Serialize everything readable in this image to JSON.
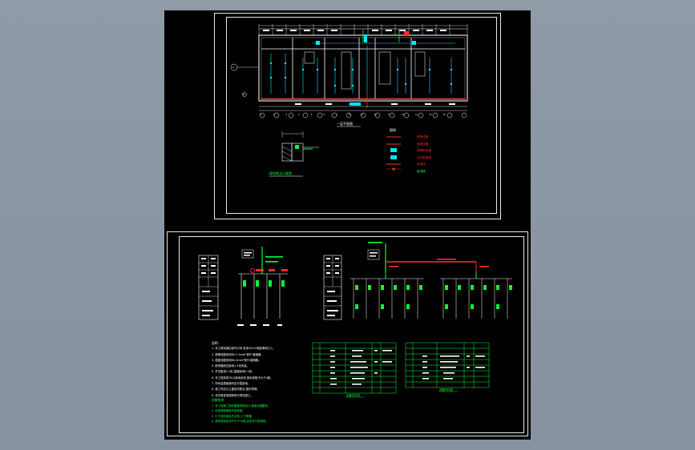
{
  "sheet1": {
    "grid_numbers": [
      "1",
      "2",
      "3",
      "4",
      "5",
      "6",
      "7",
      "8",
      "9",
      "10",
      "11",
      "12",
      "13",
      "14",
      "15",
      "16"
    ],
    "side_labels": [
      "A",
      "B"
    ],
    "plan_caption": "一层平面图",
    "detail_caption": "接地做法示意图",
    "legend_title": "图例",
    "legend_items": [
      "照明线路",
      "插座线路",
      "照明配电箱",
      "动力配电箱",
      "接地线",
      "接地极"
    ]
  },
  "sheet2": {
    "notes_title": "说明:",
    "notes": [
      "1. 本工程电源由室外引来,采用YJV22电缆埋地引入。",
      "2. 照明线路采用BV-2.5mm²穿PC管暗敷。",
      "3. 插座线路采用BV-4mm²穿PC管暗敷。",
      "4. 配电箱底边距地1.5米安装。",
      "5. 开关距地1.3米,插座距地0.3米。",
      "6. 本工程采用TN-S接地系统,接地电阻不大于4欧。",
      "7. 所有金属管道均应可靠接地。",
      "8. 施工时应与土建密切配合,做好预埋。",
      "9. 未尽事宜按国家现行规范施工。"
    ],
    "green_title": "防雷接地:",
    "green_notes": [
      "1. 本工程按三类防雷建筑物设计,屋面设避雷带。",
      "2. 利用基础钢筋作接地极。",
      "3. 引下线利用柱内主筋,上下焊通。",
      "4. 接地电阻实测不大于10欧,否则补打接地极。"
    ],
    "table1_caption": "设备材料表",
    "table2_caption": "设备材料表"
  }
}
